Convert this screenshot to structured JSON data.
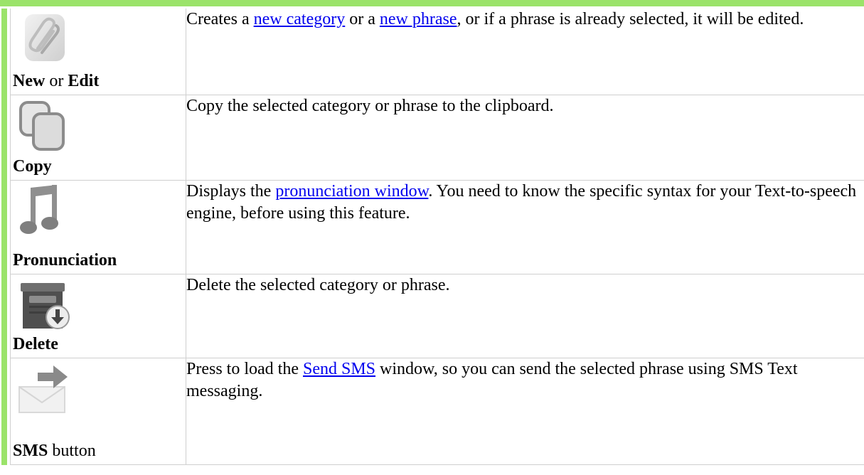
{
  "rows": [
    {
      "icon": "paperclip-icon",
      "label_parts": [
        {
          "text": "New",
          "bold": true
        },
        {
          "text": " or ",
          "bold": false
        },
        {
          "text": "Edit",
          "bold": true
        }
      ],
      "desc_parts": [
        {
          "text": "Creates a "
        },
        {
          "text": "new category",
          "link": true
        },
        {
          "text": " or a "
        },
        {
          "text": "new phrase",
          "link": true
        },
        {
          "text": ", or if a phrase is already selected, it will be edited."
        }
      ]
    },
    {
      "icon": "copy-icon",
      "label_parts": [
        {
          "text": "Copy",
          "bold": true
        }
      ],
      "desc_parts": [
        {
          "text": "Copy the selected category or phrase to the clipboard."
        }
      ]
    },
    {
      "icon": "music-note-icon",
      "label_parts": [
        {
          "text": "Pronunciation",
          "bold": true
        }
      ],
      "desc_parts": [
        {
          "text": "Displays the "
        },
        {
          "text": "pronunciation window",
          "link": true
        },
        {
          "text": ". You need to know the specific syntax for your Text-to-speech engine, before using this feature."
        }
      ]
    },
    {
      "icon": "delete-archive-icon",
      "label_parts": [
        {
          "text": "Delete",
          "bold": true
        }
      ],
      "desc_parts": [
        {
          "text": "Delete the selected category or phrase."
        }
      ]
    },
    {
      "icon": "send-sms-icon",
      "label_parts": [
        {
          "text": "SMS",
          "bold": true
        },
        {
          "text": " button",
          "bold": false
        }
      ],
      "desc_parts": [
        {
          "text": "Press to load the "
        },
        {
          "text": "Send SMS",
          "link": true
        },
        {
          "text": " window, so you can send the selected phrase using SMS Text messaging."
        }
      ]
    }
  ]
}
